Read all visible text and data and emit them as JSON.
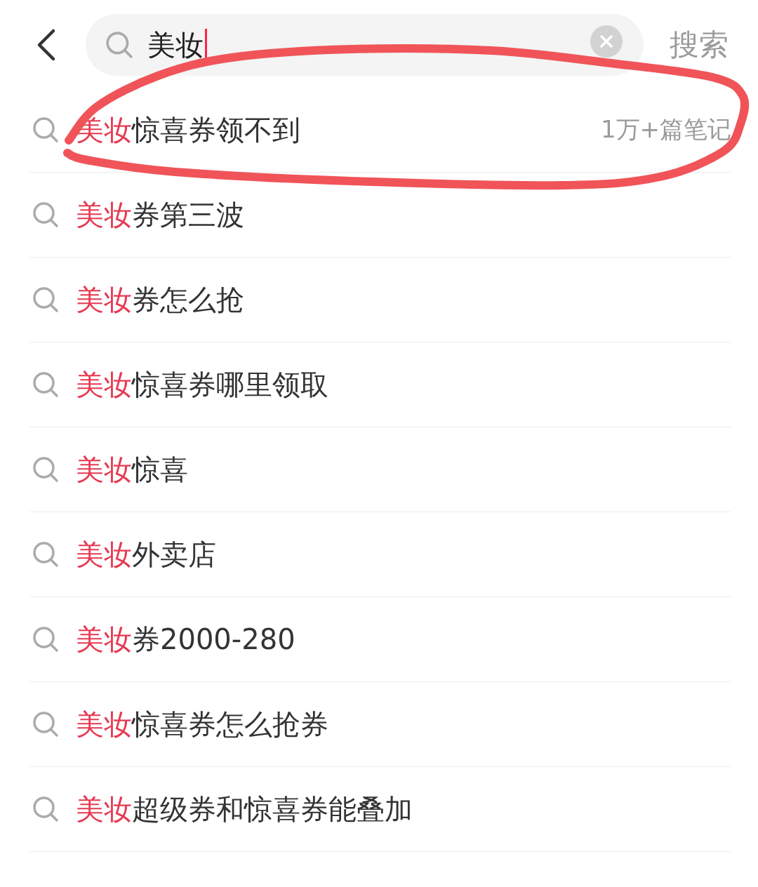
{
  "search_bar": {
    "query": "美妆",
    "focused": true,
    "action": "搜索"
  },
  "suggestions": [
    {
      "match": "美妆",
      "rest": "惊喜券领不到",
      "note_count": "1万+篇笔记",
      "circled": true
    },
    {
      "match": "美妆",
      "rest": "券第三波",
      "circled": false
    },
    {
      "match": "美妆",
      "rest": "券怎么抢",
      "circled": false
    },
    {
      "match": "美妆",
      "rest": "惊喜券哪里领取",
      "circled": false
    },
    {
      "match": "美妆",
      "rest": "惊喜",
      "circled": false
    },
    {
      "match": "美妆",
      "rest": "外卖店",
      "circled": false
    },
    {
      "match": "美妆",
      "rest": "券2000-280",
      "circled": false
    },
    {
      "match": "美妆",
      "rest": "惊喜券怎么抢券",
      "circled": false
    },
    {
      "match": "美妆",
      "rest": "超级券和惊喜券能叠加",
      "circled": false
    }
  ]
}
